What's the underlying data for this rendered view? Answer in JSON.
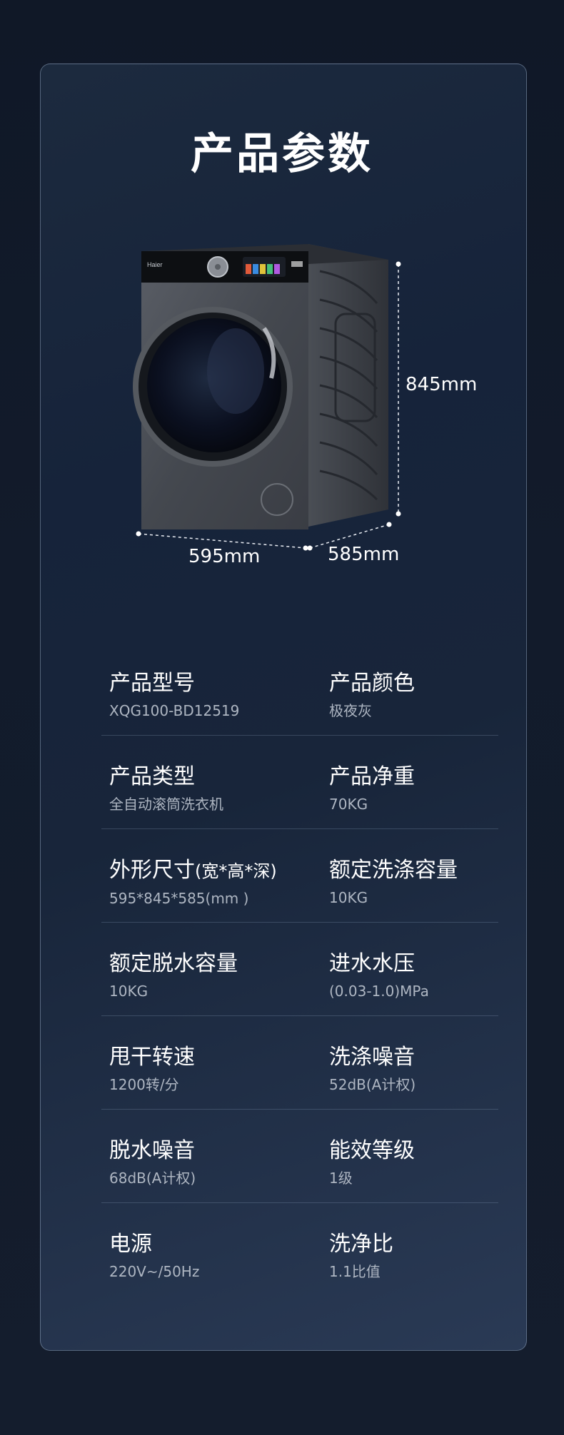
{
  "page_title": "产品参数",
  "dimensions": {
    "width": "595mm",
    "height": "845mm",
    "depth": "585mm"
  },
  "brand_logo_text": "Haier",
  "specs": [
    {
      "left": {
        "label": "产品型号",
        "value": "XQG100-BD12519"
      },
      "right": {
        "label": "产品颜色",
        "value": "极夜灰"
      }
    },
    {
      "left": {
        "label": "产品类型",
        "value": "全自动滚筒洗衣机"
      },
      "right": {
        "label": "产品净重",
        "value": "70KG"
      }
    },
    {
      "left": {
        "label": "外形尺寸",
        "label_suffix": "(宽*高*深)",
        "value": "595*845*585(mm )"
      },
      "right": {
        "label": "额定洗涤容量",
        "value": "10KG"
      }
    },
    {
      "left": {
        "label": "额定脱水容量",
        "value": "10KG"
      },
      "right": {
        "label": "进水水压",
        "value": "(0.03-1.0)MPa"
      }
    },
    {
      "left": {
        "label": "甩干转速",
        "value": "1200转/分"
      },
      "right": {
        "label": "洗涤噪音",
        "value": "52dB(A计权)"
      }
    },
    {
      "left": {
        "label": "脱水噪音",
        "value": "68dB(A计权)"
      },
      "right": {
        "label": "能效等级",
        "value": "1级"
      }
    },
    {
      "left": {
        "label": "电源",
        "value": "220V~/50Hz"
      },
      "right": {
        "label": "洗净比",
        "value": "1.1比值"
      }
    }
  ]
}
